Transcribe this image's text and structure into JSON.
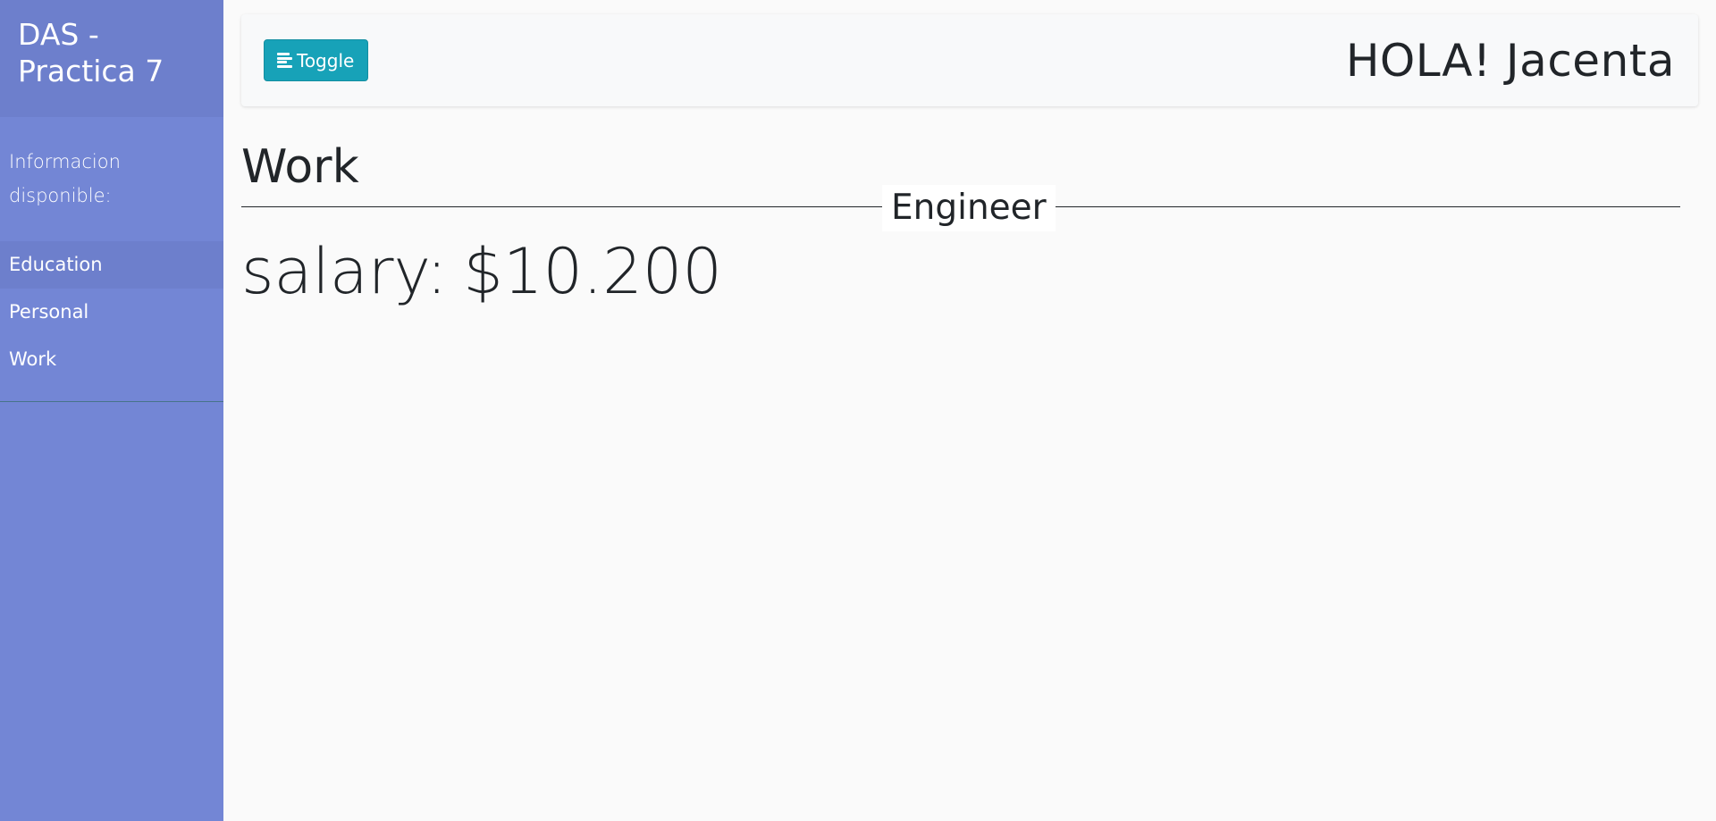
{
  "sidebar": {
    "title": "DAS - Practica 7",
    "info": "Informacion disponible:",
    "items": [
      {
        "label": "Education",
        "active": true
      },
      {
        "label": "Personal",
        "active": false
      },
      {
        "label": "Work",
        "active": false
      }
    ],
    "bg_color": "#7386d5",
    "header_color": "#6d7fcc"
  },
  "navbar": {
    "toggle_label": "Toggle",
    "toggle_icon": "align-left-icon",
    "toggle_color": "#17a2b8",
    "greeting": "HOLA! Jacenta"
  },
  "main": {
    "section_title": "Work",
    "job_title": "Engineer",
    "salary_label": "salary:",
    "salary_value": "$10.200"
  }
}
